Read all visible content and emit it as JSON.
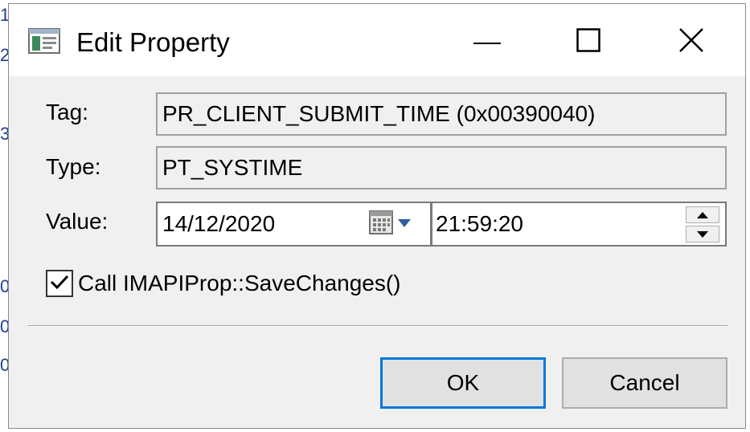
{
  "background": {
    "edge_chars": [
      "1",
      "2",
      "3",
      "0",
      "0",
      "0"
    ]
  },
  "window": {
    "title": "Edit Property",
    "controls": {
      "minimize_icon": "minimize-icon",
      "maximize_icon": "maximize-icon",
      "close_icon": "close-icon"
    }
  },
  "form": {
    "tag_label": "Tag:",
    "tag_value": "PR_CLIENT_SUBMIT_TIME (0x00390040)",
    "type_label": "Type:",
    "type_value": "PT_SYSTIME",
    "value_label": "Value:",
    "date_value": "14/12/2020",
    "time_value": "21:59:20",
    "save_changes_label": "Call IMAPIProp::SaveChanges()",
    "save_changes_checked": true
  },
  "buttons": {
    "ok_label": "OK",
    "cancel_label": "Cancel"
  },
  "colors": {
    "dialog_bg": "#f0f0f0",
    "focus_border": "#0078d7",
    "background_text": "#1f3f8f"
  }
}
